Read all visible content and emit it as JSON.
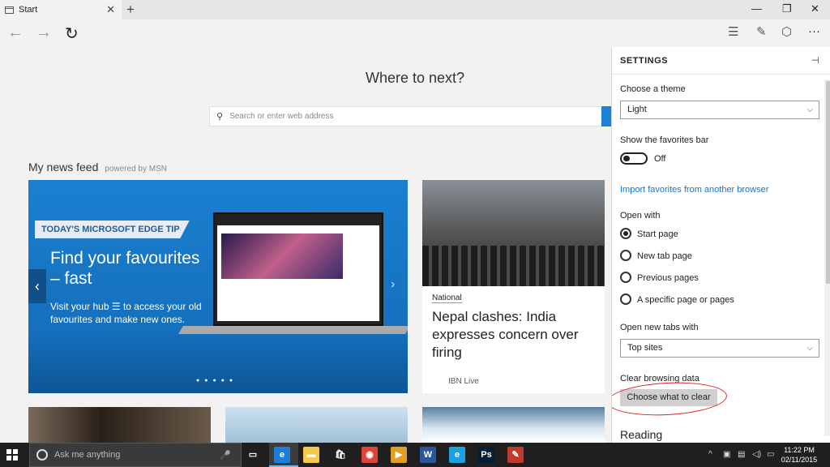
{
  "tabbar": {
    "tab_title": "Start",
    "close_glyph": "✕",
    "new_tab_glyph": "+",
    "minimize_glyph": "—",
    "restore_glyph": "❐",
    "close_window_glyph": "✕"
  },
  "nav": {
    "back_glyph": "←",
    "forward_glyph": "→",
    "refresh_glyph": "↻",
    "hub_glyph": "☰",
    "note_glyph": "✎",
    "share_glyph": "⬡",
    "more_glyph": "···"
  },
  "main": {
    "heading": "Where to next?",
    "search_placeholder": "Search or enter web address",
    "feed_title": "My news feed",
    "feed_powered": "powered by MSN",
    "hero": {
      "badge": "TODAY'S MICROSOFT EDGE TIP",
      "title": "Find your favourites – fast",
      "desc_before": "Visit your hub",
      "desc_after": "to access your old favourites and make new ones.",
      "prev_glyph": "‹",
      "next_glyph": "›",
      "dots": "●●●●●"
    },
    "news": {
      "category": "National",
      "headline": "Nepal clashes: India expresses concern over firing",
      "source": "IBN Live"
    }
  },
  "settings": {
    "title": "SETTINGS",
    "pin_glyph": "⊣",
    "theme_label": "Choose a theme",
    "theme_value": "Light",
    "favbar_label": "Show the favorites bar",
    "favbar_state": "Off",
    "import_link": "Import favorites from another browser",
    "open_with_label": "Open with",
    "open_with_options": [
      "Start page",
      "New tab page",
      "Previous pages",
      "A specific page or pages"
    ],
    "open_with_selected": 0,
    "new_tabs_label": "Open new tabs with",
    "new_tabs_value": "Top sites",
    "clear_label": "Clear browsing data",
    "clear_button": "Choose what to clear",
    "reading_label": "Reading",
    "chevron_glyph": "⌵"
  },
  "taskbar": {
    "search_placeholder": "Ask me anything",
    "mic_glyph": "🎤",
    "clock_time": "11:22 PM",
    "clock_date": "02/11/2015",
    "tray_glyph": "^",
    "apps": [
      {
        "name": "task-view",
        "glyph": "▭",
        "color": "#1f1f1f"
      },
      {
        "name": "edge",
        "glyph": "e",
        "color": "#1e7fd8"
      },
      {
        "name": "file-explorer",
        "glyph": "▬",
        "color": "#f2c94c"
      },
      {
        "name": "store",
        "glyph": "🛍",
        "color": "#1f1f1f"
      },
      {
        "name": "chrome",
        "glyph": "◉",
        "color": "#db4437"
      },
      {
        "name": "media-player",
        "glyph": "▶",
        "color": "#e0a020"
      },
      {
        "name": "word",
        "glyph": "W",
        "color": "#2b579a"
      },
      {
        "name": "internet-explorer",
        "glyph": "e",
        "color": "#1ba1e2"
      },
      {
        "name": "photoshop",
        "glyph": "Ps",
        "color": "#001e36"
      },
      {
        "name": "paint",
        "glyph": "✎",
        "color": "#c0392b"
      }
    ]
  }
}
